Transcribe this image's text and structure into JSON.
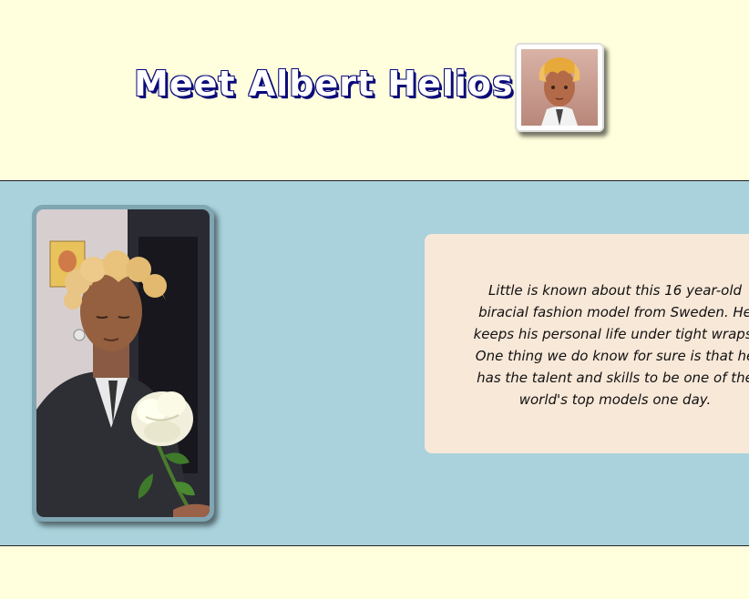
{
  "header": {
    "title": "Meet Albert Helios."
  },
  "bio": {
    "text": "Little is known about this 16 year-old biracial fashion model from Sweden. He keeps his personal life under tight wraps. One thing we do know for sure is that he has the talent and skills to be one of the world's top models one day."
  },
  "colors": {
    "page_bg": "#ffffdd",
    "band_bg": "#a9d2dd",
    "card_bg": "#f8e8d8",
    "title_shadow": "#0a0a7a"
  }
}
